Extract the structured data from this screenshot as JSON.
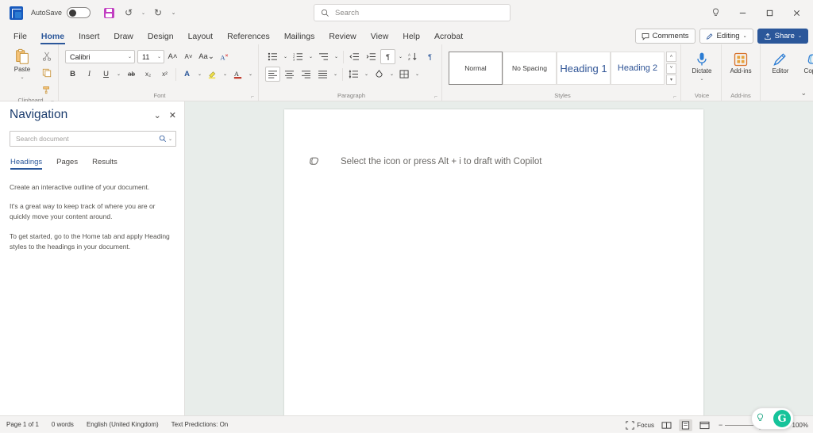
{
  "titlebar": {
    "app_icon": "word-logo",
    "autosave_label": "AutoSave",
    "autosave_state": "Off",
    "quick_access": [
      {
        "name": "save-icon",
        "label": "Save"
      },
      {
        "name": "undo-icon",
        "label": "↺"
      },
      {
        "name": "undo-caret-icon",
        "label": "⌄"
      },
      {
        "name": "redo-icon",
        "label": "↻"
      },
      {
        "name": "qat-more-icon",
        "label": "⌄"
      }
    ],
    "window_controls": [
      {
        "name": "help-lightbulb-icon",
        "glyph": "♀"
      },
      {
        "name": "minimize-button",
        "glyph": "─"
      },
      {
        "name": "restore-button",
        "glyph": "❐"
      },
      {
        "name": "close-button",
        "glyph": "✕"
      }
    ]
  },
  "search": {
    "placeholder": "Search",
    "icon": "search-icon"
  },
  "ribbon": {
    "tabs": [
      {
        "label": "File",
        "active": false
      },
      {
        "label": "Home",
        "active": true
      },
      {
        "label": "Insert",
        "active": false
      },
      {
        "label": "Draw",
        "active": false
      },
      {
        "label": "Design",
        "active": false
      },
      {
        "label": "Layout",
        "active": false
      },
      {
        "label": "References",
        "active": false
      },
      {
        "label": "Mailings",
        "active": false
      },
      {
        "label": "Review",
        "active": false
      },
      {
        "label": "View",
        "active": false
      },
      {
        "label": "Help",
        "active": false
      },
      {
        "label": "Acrobat",
        "active": false
      }
    ],
    "comments_label": "Comments",
    "editing_label": "Editing",
    "share_label": "Share",
    "collapse_icon": "chevron-down-icon",
    "groups": {
      "clipboard": {
        "label": "Clipboard",
        "paste_label": "Paste",
        "buttons": [
          "cut-icon",
          "copy-icon",
          "format-painter-icon"
        ]
      },
      "font": {
        "label": "Font",
        "font_name": "Calibri",
        "font_size": "11",
        "buttons": [
          "grow-font-icon",
          "shrink-font-icon",
          "change-case-icon",
          "clear-formatting-icon",
          "bold-icon",
          "italic-icon",
          "underline-icon",
          "strikethrough-icon",
          "subscript-icon",
          "superscript-icon",
          "text-effects-icon",
          "highlight-icon",
          "font-color-icon"
        ]
      },
      "paragraph": {
        "label": "Paragraph",
        "buttons": [
          "bullets-icon",
          "numbering-icon",
          "multilevel-list-icon",
          "decrease-indent-icon",
          "increase-indent-icon",
          "sort-icon",
          "show-marks-icon",
          "align-left-icon",
          "align-center-icon",
          "align-right-icon",
          "justify-icon",
          "line-spacing-icon",
          "shading-icon",
          "borders-icon"
        ]
      },
      "styles": {
        "label": "Styles",
        "items": [
          {
            "label": "Normal",
            "selected": true
          },
          {
            "label": "No Spacing",
            "selected": false
          },
          {
            "label": "Heading 1",
            "selected": false
          },
          {
            "label": "Heading 2",
            "selected": false
          }
        ]
      },
      "voice": {
        "label": "Voice",
        "button_label": "Dictate"
      },
      "addins": {
        "label": "Add-ins",
        "button_label": "Add-ins"
      },
      "editor": {
        "button_label": "Editor"
      },
      "copilot": {
        "button_label": "Copilot"
      }
    }
  },
  "navigation": {
    "title": "Navigation",
    "collapse_icon": "chevron-down-icon",
    "close_icon": "close-icon",
    "search_placeholder": "Search document",
    "search_icon": "search-icon",
    "tabs": [
      {
        "label": "Headings",
        "active": true
      },
      {
        "label": "Pages",
        "active": false
      },
      {
        "label": "Results",
        "active": false
      }
    ],
    "body": [
      "Create an interactive outline of your document.",
      "It's a great way to keep track of where you are or quickly move your content around.",
      "To get started, go to the Home tab and apply Heading styles to the headings in your document."
    ]
  },
  "document": {
    "copilot_icon": "copilot-icon",
    "copilot_prompt": "Select the icon or press Alt + i to draft with Copilot"
  },
  "statusbar": {
    "page": "Page 1 of 1",
    "words": "0 words",
    "language": "English (United Kingdom)",
    "predictions": "Text Predictions: On",
    "focus_label": "Focus",
    "views": [
      {
        "name": "read-mode-view-button",
        "active": false
      },
      {
        "name": "print-layout-view-button",
        "active": true
      },
      {
        "name": "web-layout-view-button",
        "active": false
      }
    ],
    "zoom_out": "−",
    "zoom_in": "+",
    "zoom_level": "100%"
  },
  "grammarly": {
    "bulb_icon": "lightbulb-icon",
    "logo_letter": "G"
  }
}
